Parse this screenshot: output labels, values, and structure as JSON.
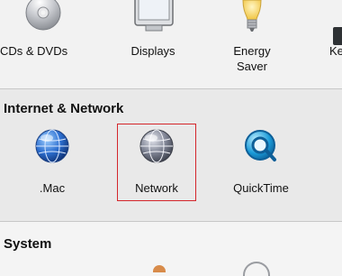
{
  "panes_top": [
    {
      "label": "CDs & DVDs",
      "icon": "cd-icon"
    },
    {
      "label": "Displays",
      "icon": "display-icon"
    },
    {
      "label": "Energy\nSaver",
      "icon": "lightbulb-icon"
    },
    {
      "label": "Ke",
      "icon": "keyboard-icon"
    }
  ],
  "sections": {
    "internet": {
      "title": "Internet & Network",
      "panes": [
        {
          "label": ".Mac",
          "icon": "globe-icon"
        },
        {
          "label": "Network",
          "icon": "network-globe-icon"
        },
        {
          "label": "QuickTime",
          "icon": "quicktime-icon"
        }
      ]
    },
    "system": {
      "title": "System"
    }
  },
  "selection_color": "#d4262b"
}
